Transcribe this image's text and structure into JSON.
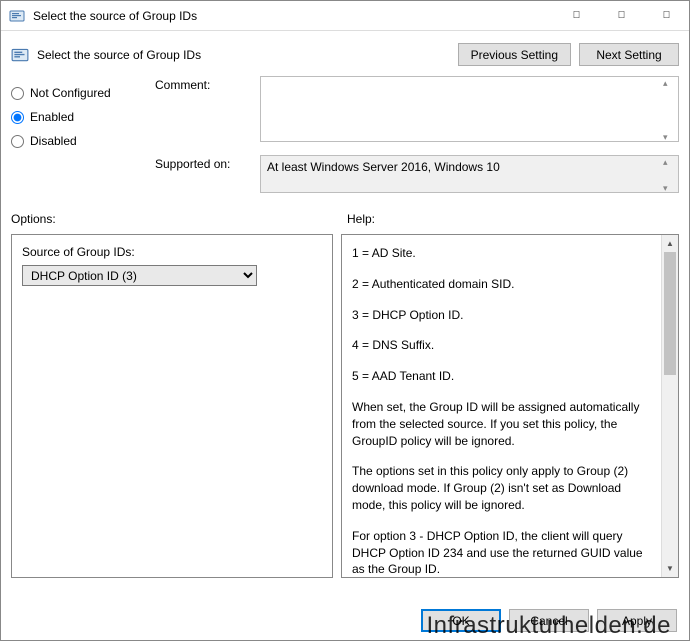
{
  "window": {
    "title": "Select the source of Group IDs"
  },
  "header": {
    "title": "Select the source of Group IDs",
    "prev_label": "Previous Setting",
    "next_label": "Next Setting"
  },
  "state": {
    "not_configured_label": "Not Configured",
    "enabled_label": "Enabled",
    "disabled_label": "Disabled",
    "selected": "enabled"
  },
  "fields": {
    "comment_label": "Comment:",
    "comment_value": "",
    "supported_label": "Supported on:",
    "supported_value": "At least Windows Server 2016, Windows 10"
  },
  "sections": {
    "options_label": "Options:",
    "help_label": "Help:"
  },
  "options_pane": {
    "dropdown_label": "Source of Group IDs:",
    "dropdown_value": "DHCP Option ID (3)"
  },
  "help_pane": {
    "lines": [
      "1 = AD Site.",
      "2 = Authenticated domain SID.",
      "3 = DHCP Option ID.",
      "4 = DNS Suffix.",
      "5 = AAD Tenant ID.",
      "When set, the Group ID will be assigned automatically from the selected source. If you set this policy, the GroupID policy will be ignored.",
      "The options set in this policy only apply to Group (2) download mode. If Group (2) isn't set as Download mode, this policy will be ignored.",
      "For option 3 - DHCP Option ID, the client will query DHCP Option ID 234 and use the returned GUID value as the Group ID."
    ]
  },
  "footer": {
    "ok": "OK",
    "cancel": "Cancel",
    "apply": "Apply"
  },
  "watermark": "Infrastrukturhelden.de"
}
